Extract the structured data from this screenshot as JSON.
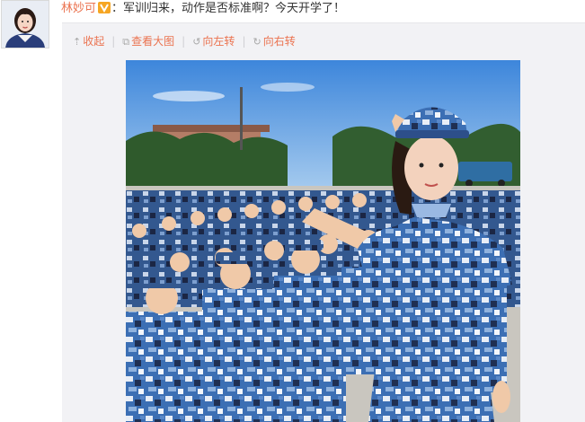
{
  "post": {
    "author": "林妙可",
    "text": "：军训归来，动作是否标准啊？今天开学了！"
  },
  "toolbar": {
    "collapse_label": "收起",
    "view_large_label": "查看大图",
    "rotate_left_label": "向左转",
    "rotate_right_label": "向右转",
    "separator": "|"
  },
  "icons": {
    "collapse": "arrow-up-icon",
    "view_large": "external-view-icon",
    "rotate_left": "rotate-left-icon",
    "rotate_right": "rotate-right-icon",
    "verified": "verified-v-icon"
  },
  "colors": {
    "link": "#eb7350",
    "card_bg": "#f2f2f5",
    "verified_badge": "#f6a623",
    "sky": "#4f93dd",
    "camo_blue": "#3c6fb4"
  }
}
